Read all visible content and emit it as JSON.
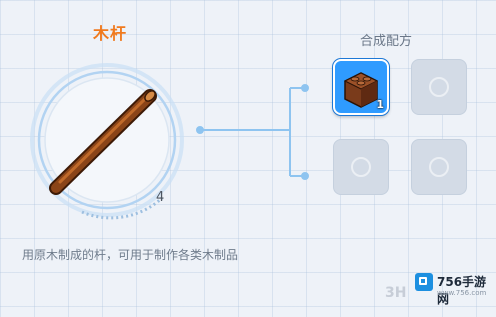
{
  "item": {
    "name": "木杆",
    "count": "4",
    "description": "用原木制成的杆，可用于制作各类木制品",
    "icon": "wooden-stick-icon"
  },
  "recipe": {
    "title": "合成配方",
    "slots": [
      {
        "filled": true,
        "icon": "brown-block-icon",
        "count": "1"
      },
      {
        "filled": false
      },
      {
        "filled": false
      },
      {
        "filled": false
      }
    ]
  },
  "colors": {
    "title": "#f07a1e",
    "ring": "#aed3f5",
    "connector": "#8ec4f0",
    "slot_selected": "#2f9bff",
    "stick": "#8a4418"
  },
  "watermark": {
    "name": "756手游网",
    "url": "www.756.com",
    "faint": "3H"
  }
}
